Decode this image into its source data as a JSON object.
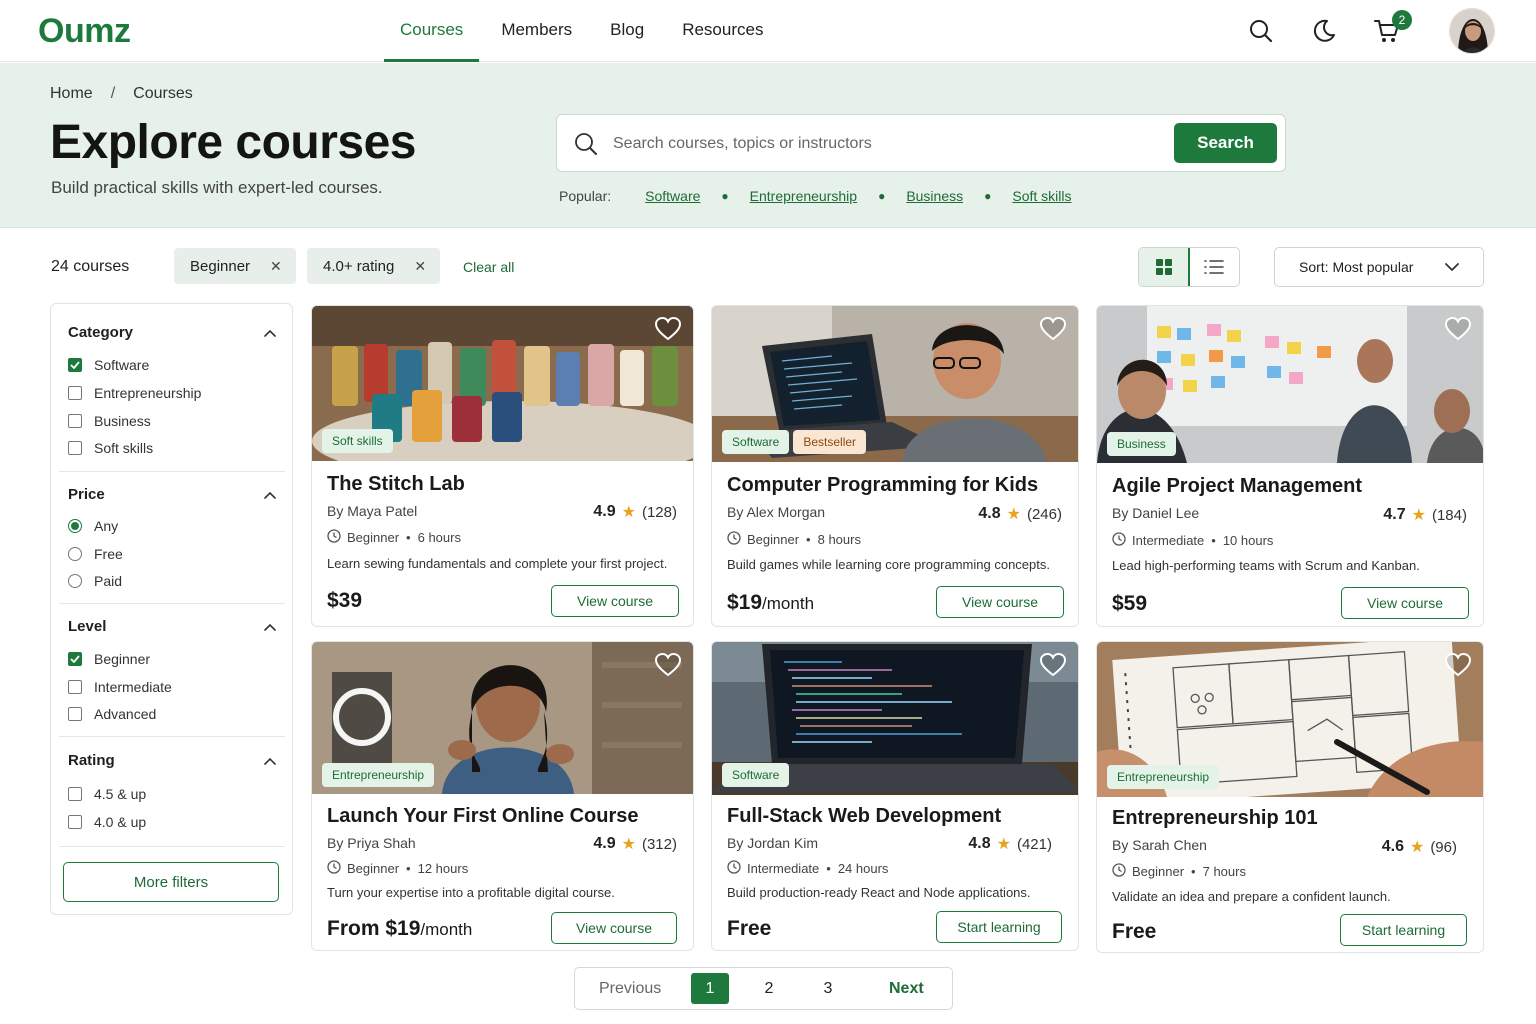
{
  "brand": {
    "logo": "Oumz",
    "accent": "#1e7a3c"
  },
  "nav": {
    "links": [
      "Courses",
      "Members",
      "Blog",
      "Resources"
    ],
    "active": "Courses",
    "cart_count": "2",
    "icons": [
      "search-icon",
      "moon-icon",
      "cart-icon"
    ]
  },
  "hero": {
    "breadcrumb": [
      "Home",
      "/",
      "Courses"
    ],
    "title": "Explore courses",
    "subtitle": "Build practical skills with expert-led courses.",
    "search_placeholder": "Search courses, topics or instructors",
    "search_button": "Search",
    "popular_label": "Popular:",
    "popular_tags": [
      "Software",
      "Entrepreneurship",
      "Business",
      "Soft skills"
    ]
  },
  "toolbar": {
    "count": "24 courses",
    "chips": [
      "Beginner",
      "4.0+ rating"
    ],
    "clear_all": "Clear all",
    "view_mode": "grid",
    "sort_label": "Sort:",
    "sort_value": "Most popular"
  },
  "filters": {
    "category": {
      "title": "Category",
      "options": [
        "Software",
        "Entrepreneurship",
        "Business",
        "Soft skills"
      ],
      "checked": [
        "Software"
      ]
    },
    "price": {
      "title": "Price",
      "options": [
        "Any",
        "Free",
        "Paid"
      ],
      "selected": "Any"
    },
    "level": {
      "title": "Level",
      "options": [
        "Beginner",
        "Intermediate",
        "Advanced"
      ],
      "checked": [
        "Beginner"
      ]
    },
    "rating": {
      "title": "Rating",
      "options": [
        "4.5 & up",
        "4.0 & up"
      ],
      "checked": []
    },
    "more_filters": "More filters"
  },
  "courses": [
    {
      "title": "The Stitch Lab",
      "author": "By Maya Patel",
      "rating": "4.9",
      "reviews": "(128)",
      "level": "Beginner",
      "duration": "6 hours",
      "desc": "Learn sewing fundamentals and complete your first project.",
      "price": "$39",
      "price_suffix": "",
      "cta": "View course",
      "tags": [
        "Soft skills"
      ],
      "image": "sewing-threads"
    },
    {
      "title": "Computer Programming for Kids",
      "author": "By Alex Morgan",
      "rating": "4.8",
      "reviews": "(246)",
      "level": "Beginner",
      "duration": "8 hours",
      "desc": "Build games while learning core programming concepts.",
      "price": "$19",
      "price_suffix": "/month",
      "cta": "View course",
      "tags": [
        "Software",
        "Bestseller"
      ],
      "image": "kid-coding-laptop"
    },
    {
      "title": "Agile Project Management",
      "author": "By Daniel Lee",
      "rating": "4.7",
      "reviews": "(184)",
      "level": "Intermediate",
      "duration": "10 hours",
      "desc": "Lead high-performing teams with Scrum and Kanban.",
      "price": "$59",
      "price_suffix": "",
      "cta": "View course",
      "tags": [
        "Business"
      ],
      "image": "kanban-board-team"
    },
    {
      "title": "Launch Your First Online Course",
      "author": "By Priya Shah",
      "rating": "4.9",
      "reviews": "(312)",
      "level": "Beginner",
      "duration": "12 hours",
      "desc": "Turn your expertise into a profitable digital course.",
      "price": "From $19",
      "price_suffix": "/month",
      "cta": "View course",
      "tags": [
        "Entrepreneurship"
      ],
      "image": "woman-recording-video"
    },
    {
      "title": "Full-Stack Web Development",
      "author": "By Jordan Kim",
      "rating": "4.8",
      "reviews": "(421)",
      "level": "Intermediate",
      "duration": "24 hours",
      "desc": "Build production-ready React and Node applications.",
      "price": "Free",
      "price_suffix": "",
      "cta": "Start learning",
      "tags": [
        "Software"
      ],
      "image": "laptop-code-editor"
    },
    {
      "title": "Entrepreneurship 101",
      "author": "By Sarah Chen",
      "rating": "4.6",
      "reviews": "(96)",
      "level": "Beginner",
      "duration": "7 hours",
      "desc": "Validate an idea and prepare a confident launch.",
      "price": "Free",
      "price_suffix": "",
      "cta": "Start learning",
      "tags": [
        "Entrepreneurship"
      ],
      "image": "business-model-sketch"
    }
  ],
  "pagination": {
    "prev": "Previous",
    "pages": [
      "1",
      "2",
      "3"
    ],
    "current": "1",
    "next": "Next"
  }
}
